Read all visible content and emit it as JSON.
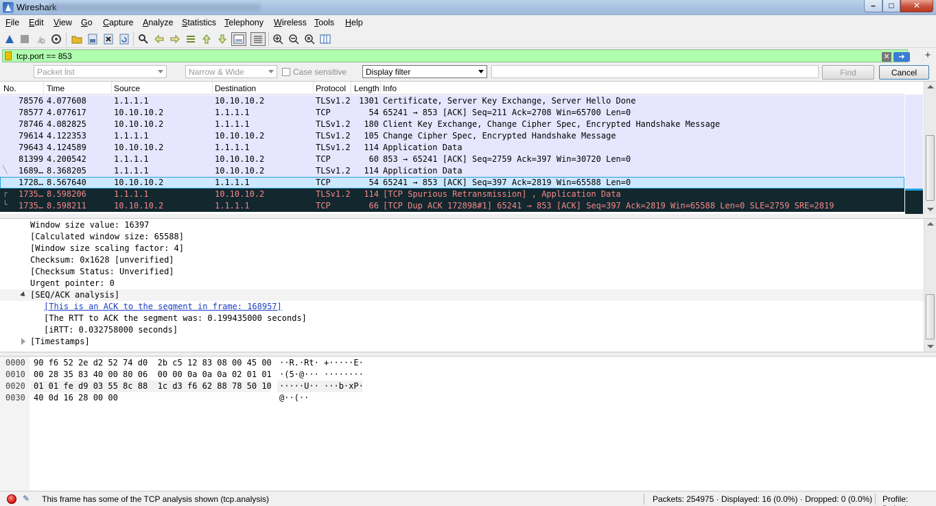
{
  "window": {
    "title": "Wireshark"
  },
  "menu": [
    "File",
    "Edit",
    "View",
    "Go",
    "Capture",
    "Analyze",
    "Statistics",
    "Telephony",
    "Wireless",
    "Tools",
    "Help"
  ],
  "filter": {
    "value": "tcp.port == 853"
  },
  "findbar": {
    "search_in": "Packet list",
    "charset": "Narrow & Wide",
    "case_label": "Case sensitive",
    "search_type": "Display filter",
    "find_label": "Find",
    "cancel_label": "Cancel"
  },
  "packet_list": {
    "columns": [
      "No.",
      "Time",
      "Source",
      "Destination",
      "Protocol",
      "Length",
      "Info"
    ],
    "rows": [
      {
        "no": "78576",
        "time": "4.077608",
        "src": "1.1.1.1",
        "dst": "10.10.10.2",
        "proto": "TLSv1.2",
        "len": "1301",
        "info": "Certificate, Server Key Exchange, Server Hello Done",
        "style": "normal"
      },
      {
        "no": "78577",
        "time": "4.077617",
        "src": "10.10.10.2",
        "dst": "1.1.1.1",
        "proto": "TCP",
        "len": "54",
        "info": "65241 → 853 [ACK] Seq=211 Ack=2708 Win=65700 Len=0",
        "style": "normal"
      },
      {
        "no": "78746",
        "time": "4.082825",
        "src": "10.10.10.2",
        "dst": "1.1.1.1",
        "proto": "TLSv1.2",
        "len": "180",
        "info": "Client Key Exchange, Change Cipher Spec, Encrypted Handshake Message",
        "style": "normal"
      },
      {
        "no": "79614",
        "time": "4.122353",
        "src": "1.1.1.1",
        "dst": "10.10.10.2",
        "proto": "TLSv1.2",
        "len": "105",
        "info": "Change Cipher Spec, Encrypted Handshake Message",
        "style": "normal"
      },
      {
        "no": "79643",
        "time": "4.124589",
        "src": "10.10.10.2",
        "dst": "1.1.1.1",
        "proto": "TLSv1.2",
        "len": "114",
        "info": "Application Data",
        "style": "normal"
      },
      {
        "no": "81399",
        "time": "4.200542",
        "src": "1.1.1.1",
        "dst": "10.10.10.2",
        "proto": "TCP",
        "len": "60",
        "info": "853 → 65241 [ACK] Seq=2759 Ack=397 Win=30720 Len=0",
        "style": "normal"
      },
      {
        "no": "1689…",
        "time": "8.368205",
        "src": "1.1.1.1",
        "dst": "10.10.10.2",
        "proto": "TLSv1.2",
        "len": "114",
        "info": "Application Data",
        "style": "normal"
      },
      {
        "no": "1728…",
        "time": "8.567640",
        "src": "10.10.10.2",
        "dst": "1.1.1.1",
        "proto": "TCP",
        "len": "54",
        "info": "65241 → 853 [ACK] Seq=397 Ack=2819 Win=65588 Len=0",
        "style": "selected"
      },
      {
        "no": "1735…",
        "time": "8.598206",
        "src": "1.1.1.1",
        "dst": "10.10.10.2",
        "proto": "TLSv1.2",
        "len": "114",
        "info": "[TCP Spurious Retransmission] , Application Data",
        "style": "dark"
      },
      {
        "no": "1735…",
        "time": "8.598211",
        "src": "10.10.10.2",
        "dst": "1.1.1.1",
        "proto": "TCP",
        "len": "66",
        "info": "[TCP Dup ACK 172898#1] 65241 → 853 [ACK] Seq=397 Ack=2819 Win=65588 Len=0 SLE=2759 SRE=2819",
        "style": "dark"
      }
    ]
  },
  "details": [
    {
      "text": "Window size value: 16397",
      "level": 0
    },
    {
      "text": "[Calculated window size: 65588]",
      "level": 0
    },
    {
      "text": "[Window size scaling factor: 4]",
      "level": 0
    },
    {
      "text": "Checksum: 0x1628 [unverified]",
      "level": 0
    },
    {
      "text": "[Checksum Status: Unverified]",
      "level": 0
    },
    {
      "text": "Urgent pointer: 0",
      "level": 0
    },
    {
      "text": "[SEQ/ACK analysis]",
      "level": 0,
      "expander": "open"
    },
    {
      "text": "[This is an ACK to the segment in frame: 168957]",
      "level": 1,
      "link": true
    },
    {
      "text": "[The RTT to ACK the segment was: 0.199435000 seconds]",
      "level": 1
    },
    {
      "text": "[iRTT: 0.032758000 seconds]",
      "level": 1
    },
    {
      "text": "[Timestamps]",
      "level": 0,
      "expander": "closed"
    }
  ],
  "bytes": [
    {
      "offset": "0000",
      "hex": "90 f6 52 2e d2 52 74 d0  2b c5 12 83 08 00 45 00",
      "ascii": "··R.·Rt· +·····E·"
    },
    {
      "offset": "0010",
      "hex": "00 28 35 83 40 00 80 06  00 00 0a 0a 0a 02 01 01",
      "ascii": "·(5·@··· ········"
    },
    {
      "offset": "0020",
      "hex": "01 01 fe d9 03 55 8c 88  1c d3 f6 62 88 78 50 10",
      "ascii": "·····U·· ···b·xP·"
    },
    {
      "offset": "0030",
      "hex": "40 0d 16 28 00 00",
      "ascii": "@··(··"
    }
  ],
  "status": {
    "message": "This frame has some of the TCP analysis shown (tcp.analysis)",
    "packets": "Packets: 254975 · Displayed: 16 (0.0%) · Dropped: 0 (0.0%)",
    "profile": "Profile: Default"
  }
}
